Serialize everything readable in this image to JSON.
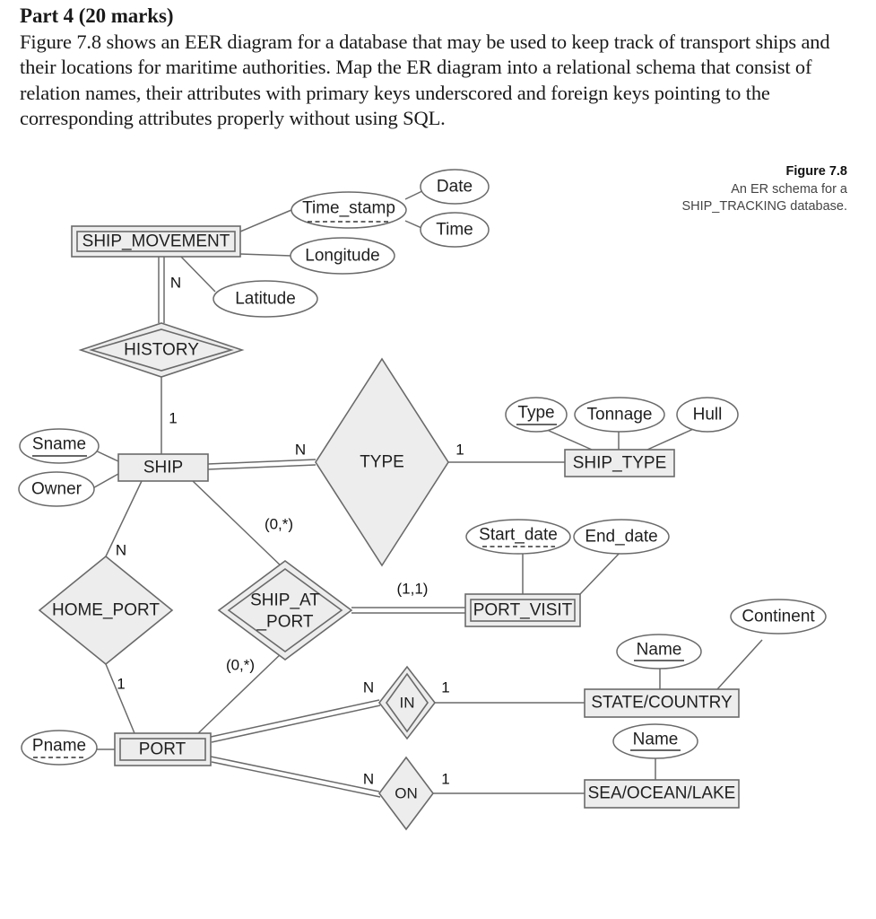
{
  "question": {
    "title": "Part 4 (20 marks)",
    "body": "Figure 7.8 shows an EER diagram for a database that may be used to keep track of transport ships and their locations for maritime authorities. Map the ER diagram into a relational schema that consist of relation names, their attributes with primary keys underscored and foreign keys pointing to the corresponding attributes properly without using SQL."
  },
  "figure": {
    "caption_title": "Figure 7.8",
    "caption_line1": "An ER schema for a",
    "caption_line2": "SHIP_TRACKING database."
  },
  "colors": {
    "shape_fill": "#ededed",
    "attribute_fill": "#ffffff",
    "stroke": "#555555",
    "text": "#1f1f1f"
  },
  "diagram": {
    "entities": [
      {
        "id": "ship_movement",
        "label": "SHIP_MOVEMENT",
        "kind": "weak-entity"
      },
      {
        "id": "ship",
        "label": "SHIP",
        "kind": "entity"
      },
      {
        "id": "ship_type",
        "label": "SHIP_TYPE",
        "kind": "entity"
      },
      {
        "id": "port_visit",
        "label": "PORT_VISIT",
        "kind": "weak-entity"
      },
      {
        "id": "port",
        "label": "PORT",
        "kind": "weak-entity"
      },
      {
        "id": "state_country",
        "label": "STATE/COUNTRY",
        "kind": "entity"
      },
      {
        "id": "sea_ocean_lake",
        "label": "SEA/OCEAN/LAKE",
        "kind": "entity"
      }
    ],
    "relationships": [
      {
        "id": "history",
        "label": "HISTORY",
        "kind": "identifying-relationship"
      },
      {
        "id": "type",
        "label": "TYPE",
        "kind": "relationship"
      },
      {
        "id": "home_port",
        "label": "HOME_PORT",
        "kind": "relationship"
      },
      {
        "id": "ship_at_port",
        "label": "SHIP_AT\n_PORT",
        "label_line1": "SHIP_AT",
        "label_line2": "_PORT",
        "kind": "identifying-relationship"
      },
      {
        "id": "in",
        "label": "IN",
        "kind": "identifying-relationship"
      },
      {
        "id": "on",
        "label": "ON",
        "kind": "relationship"
      }
    ],
    "attributes": [
      {
        "id": "time_stamp",
        "label": "Time_stamp",
        "key": "partial",
        "owner": "ship_movement"
      },
      {
        "id": "date",
        "label": "Date",
        "key": "none",
        "owner": "time_stamp"
      },
      {
        "id": "time",
        "label": "Time",
        "key": "none",
        "owner": "time_stamp"
      },
      {
        "id": "longitude",
        "label": "Longitude",
        "key": "none",
        "owner": "ship_movement"
      },
      {
        "id": "latitude",
        "label": "Latitude",
        "key": "none",
        "owner": "ship_movement"
      },
      {
        "id": "sname",
        "label": "Sname",
        "key": "primary",
        "owner": "ship"
      },
      {
        "id": "owner",
        "label": "Owner",
        "key": "none",
        "owner": "ship"
      },
      {
        "id": "st_type",
        "label": "Type",
        "key": "primary",
        "owner": "ship_type"
      },
      {
        "id": "tonnage",
        "label": "Tonnage",
        "key": "none",
        "owner": "ship_type"
      },
      {
        "id": "hull",
        "label": "Hull",
        "key": "none",
        "owner": "ship_type"
      },
      {
        "id": "start_date",
        "label": "Start_date",
        "key": "partial",
        "owner": "port_visit"
      },
      {
        "id": "end_date",
        "label": "End_date",
        "key": "none",
        "owner": "port_visit"
      },
      {
        "id": "pname",
        "label": "Pname",
        "key": "partial",
        "owner": "port"
      },
      {
        "id": "sc_name",
        "label": "Name",
        "key": "primary",
        "owner": "state_country"
      },
      {
        "id": "continent",
        "label": "Continent",
        "key": "none",
        "owner": "state_country"
      },
      {
        "id": "sol_name",
        "label": "Name",
        "key": "primary",
        "owner": "sea_ocean_lake"
      }
    ],
    "cardinalities": [
      {
        "id": "card_sm_history",
        "text": "N",
        "edge": "ship_movement-history"
      },
      {
        "id": "card_history_ship",
        "text": "1",
        "edge": "history-ship"
      },
      {
        "id": "card_ship_type",
        "text": "N",
        "edge": "ship-type"
      },
      {
        "id": "card_type_shiptype",
        "text": "1",
        "edge": "type-ship_type"
      },
      {
        "id": "card_ship_homeport",
        "text": "N",
        "edge": "ship-home_port"
      },
      {
        "id": "card_homeport_port",
        "text": "1",
        "edge": "home_port-port"
      },
      {
        "id": "card_ship_sap",
        "text": "(0,*)",
        "edge": "ship-ship_at_port"
      },
      {
        "id": "card_port_sap",
        "text": "(0,*)",
        "edge": "port-ship_at_port"
      },
      {
        "id": "card_sap_visit",
        "text": "(1,1)",
        "edge": "ship_at_port-port_visit"
      },
      {
        "id": "card_port_in",
        "text": "N",
        "edge": "port-in"
      },
      {
        "id": "card_in_state",
        "text": "1",
        "edge": "in-state_country"
      },
      {
        "id": "card_port_on",
        "text": "N",
        "edge": "port-on"
      },
      {
        "id": "card_on_sea",
        "text": "1",
        "edge": "on-sea_ocean_lake"
      }
    ]
  }
}
